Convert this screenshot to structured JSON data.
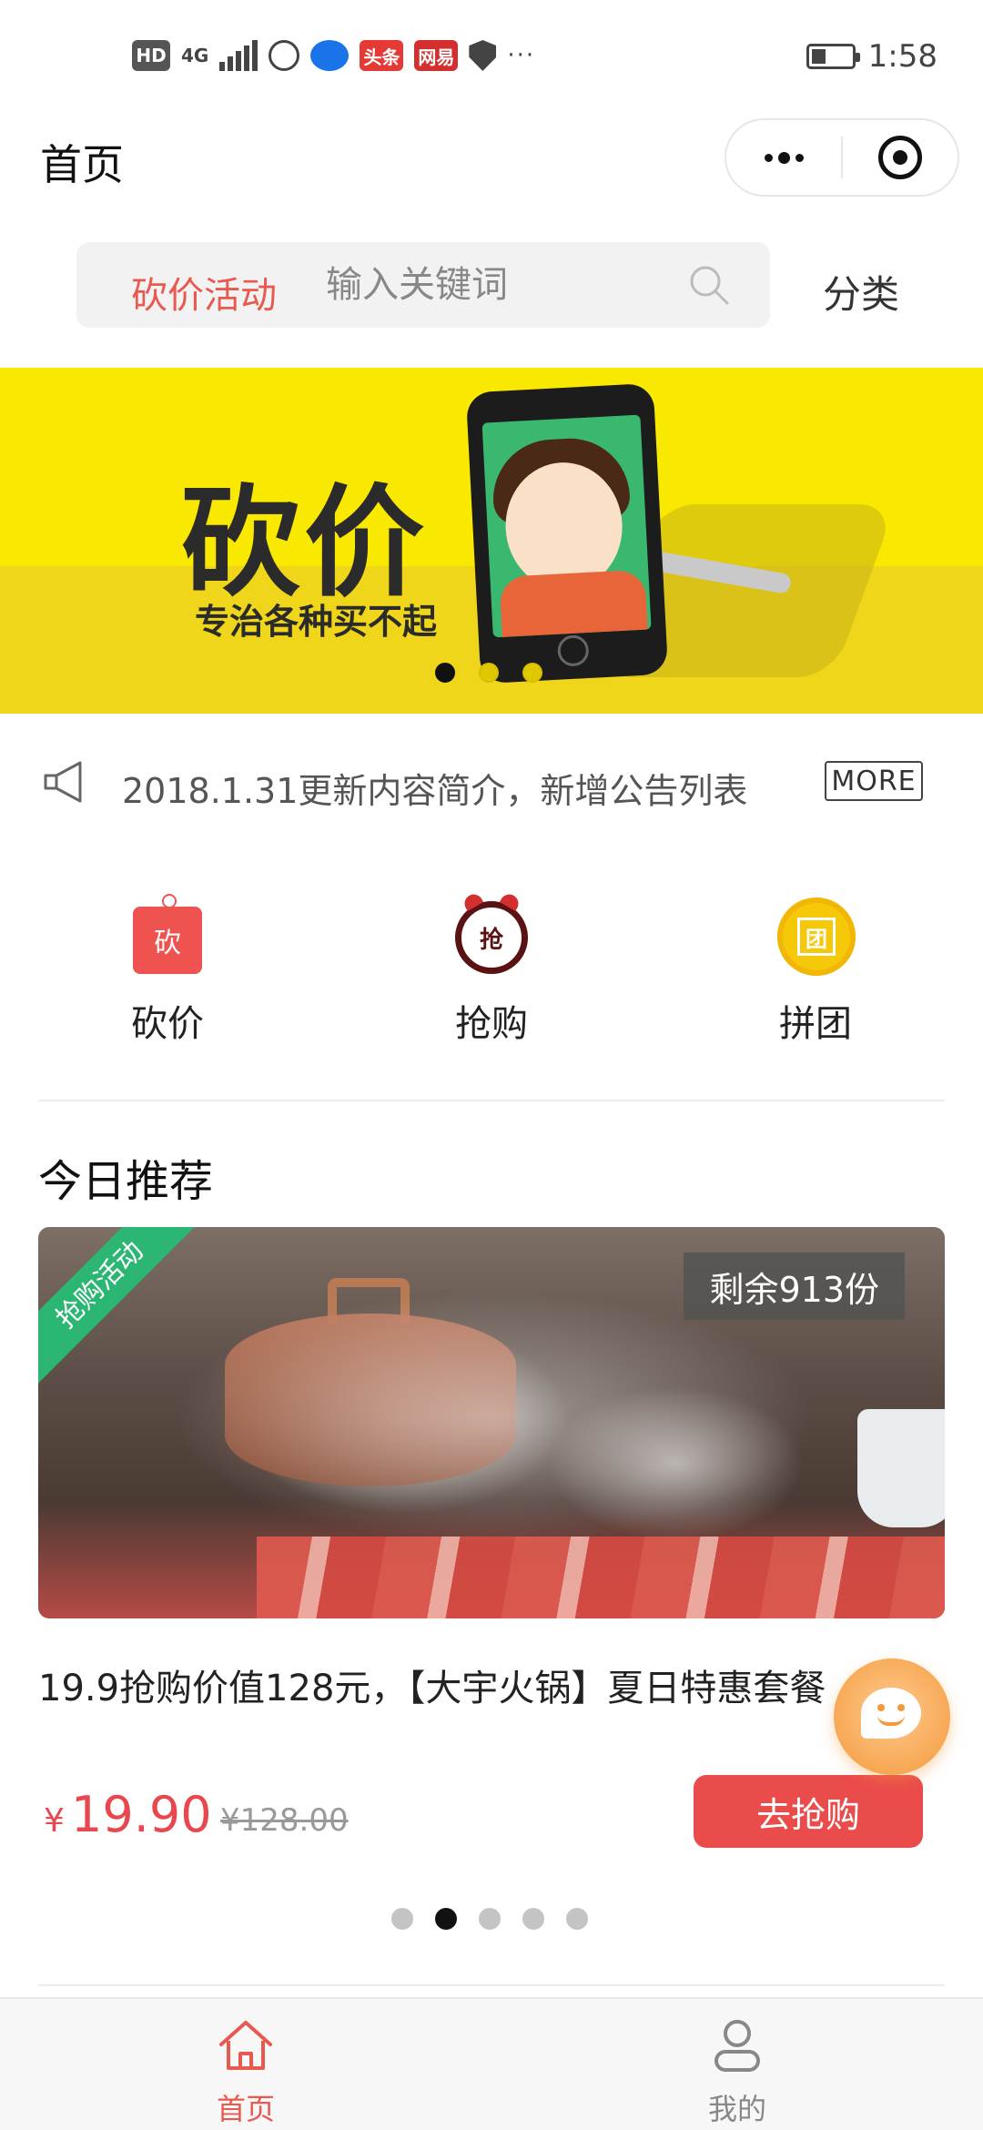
{
  "status_bar": {
    "left_icons": [
      "hd-icon",
      "4g-signal-icon",
      "globe-icon",
      "app-icon",
      "toutiao-icon",
      "netease-icon",
      "shield-icon",
      "more-notifications-icon"
    ],
    "net_label": "4G",
    "hd_label": "HD",
    "toutiao_label": "头条",
    "netease_label": "网易",
    "battery_level": 0.35,
    "time": "1:58"
  },
  "nav": {
    "title": "首页"
  },
  "search": {
    "tag": "砍价活动",
    "placeholder": "输入关键词",
    "category": "分类"
  },
  "banner": {
    "title": "砍价",
    "subtitle": "专治各种买不起",
    "active_dot": 0,
    "dot_count": 3
  },
  "notice": {
    "text": "2018.1.31更新内容简介，新增公告列表",
    "more": "MORE"
  },
  "entries": [
    {
      "label": "砍价",
      "icon_text": "砍",
      "icon": "price-tag-icon"
    },
    {
      "label": "抢购",
      "icon_text": "抢",
      "icon": "alarm-clock-icon"
    },
    {
      "label": "拼团",
      "icon_text": "团",
      "icon": "group-coin-icon"
    }
  ],
  "recommend": {
    "title": "今日推荐",
    "card": {
      "ribbon": "抢购活动",
      "stock": "剩余913份",
      "title": "19.9抢购价值128元，【大宇火锅】夏日特惠套餐",
      "currency": "¥",
      "price": "19.90",
      "original_price": "¥128.00",
      "button": "去抢购"
    },
    "pager": {
      "count": 5,
      "active": 1
    }
  },
  "tabbar": {
    "items": [
      {
        "label": "首页",
        "icon": "home-icon",
        "active": true
      },
      {
        "label": "我的",
        "icon": "user-icon",
        "active": false
      }
    ]
  },
  "colors": {
    "accent": "#e8594f",
    "button": "#ea4b4b",
    "banner_bg": "#f9e800",
    "ribbon": "#2bb673"
  }
}
